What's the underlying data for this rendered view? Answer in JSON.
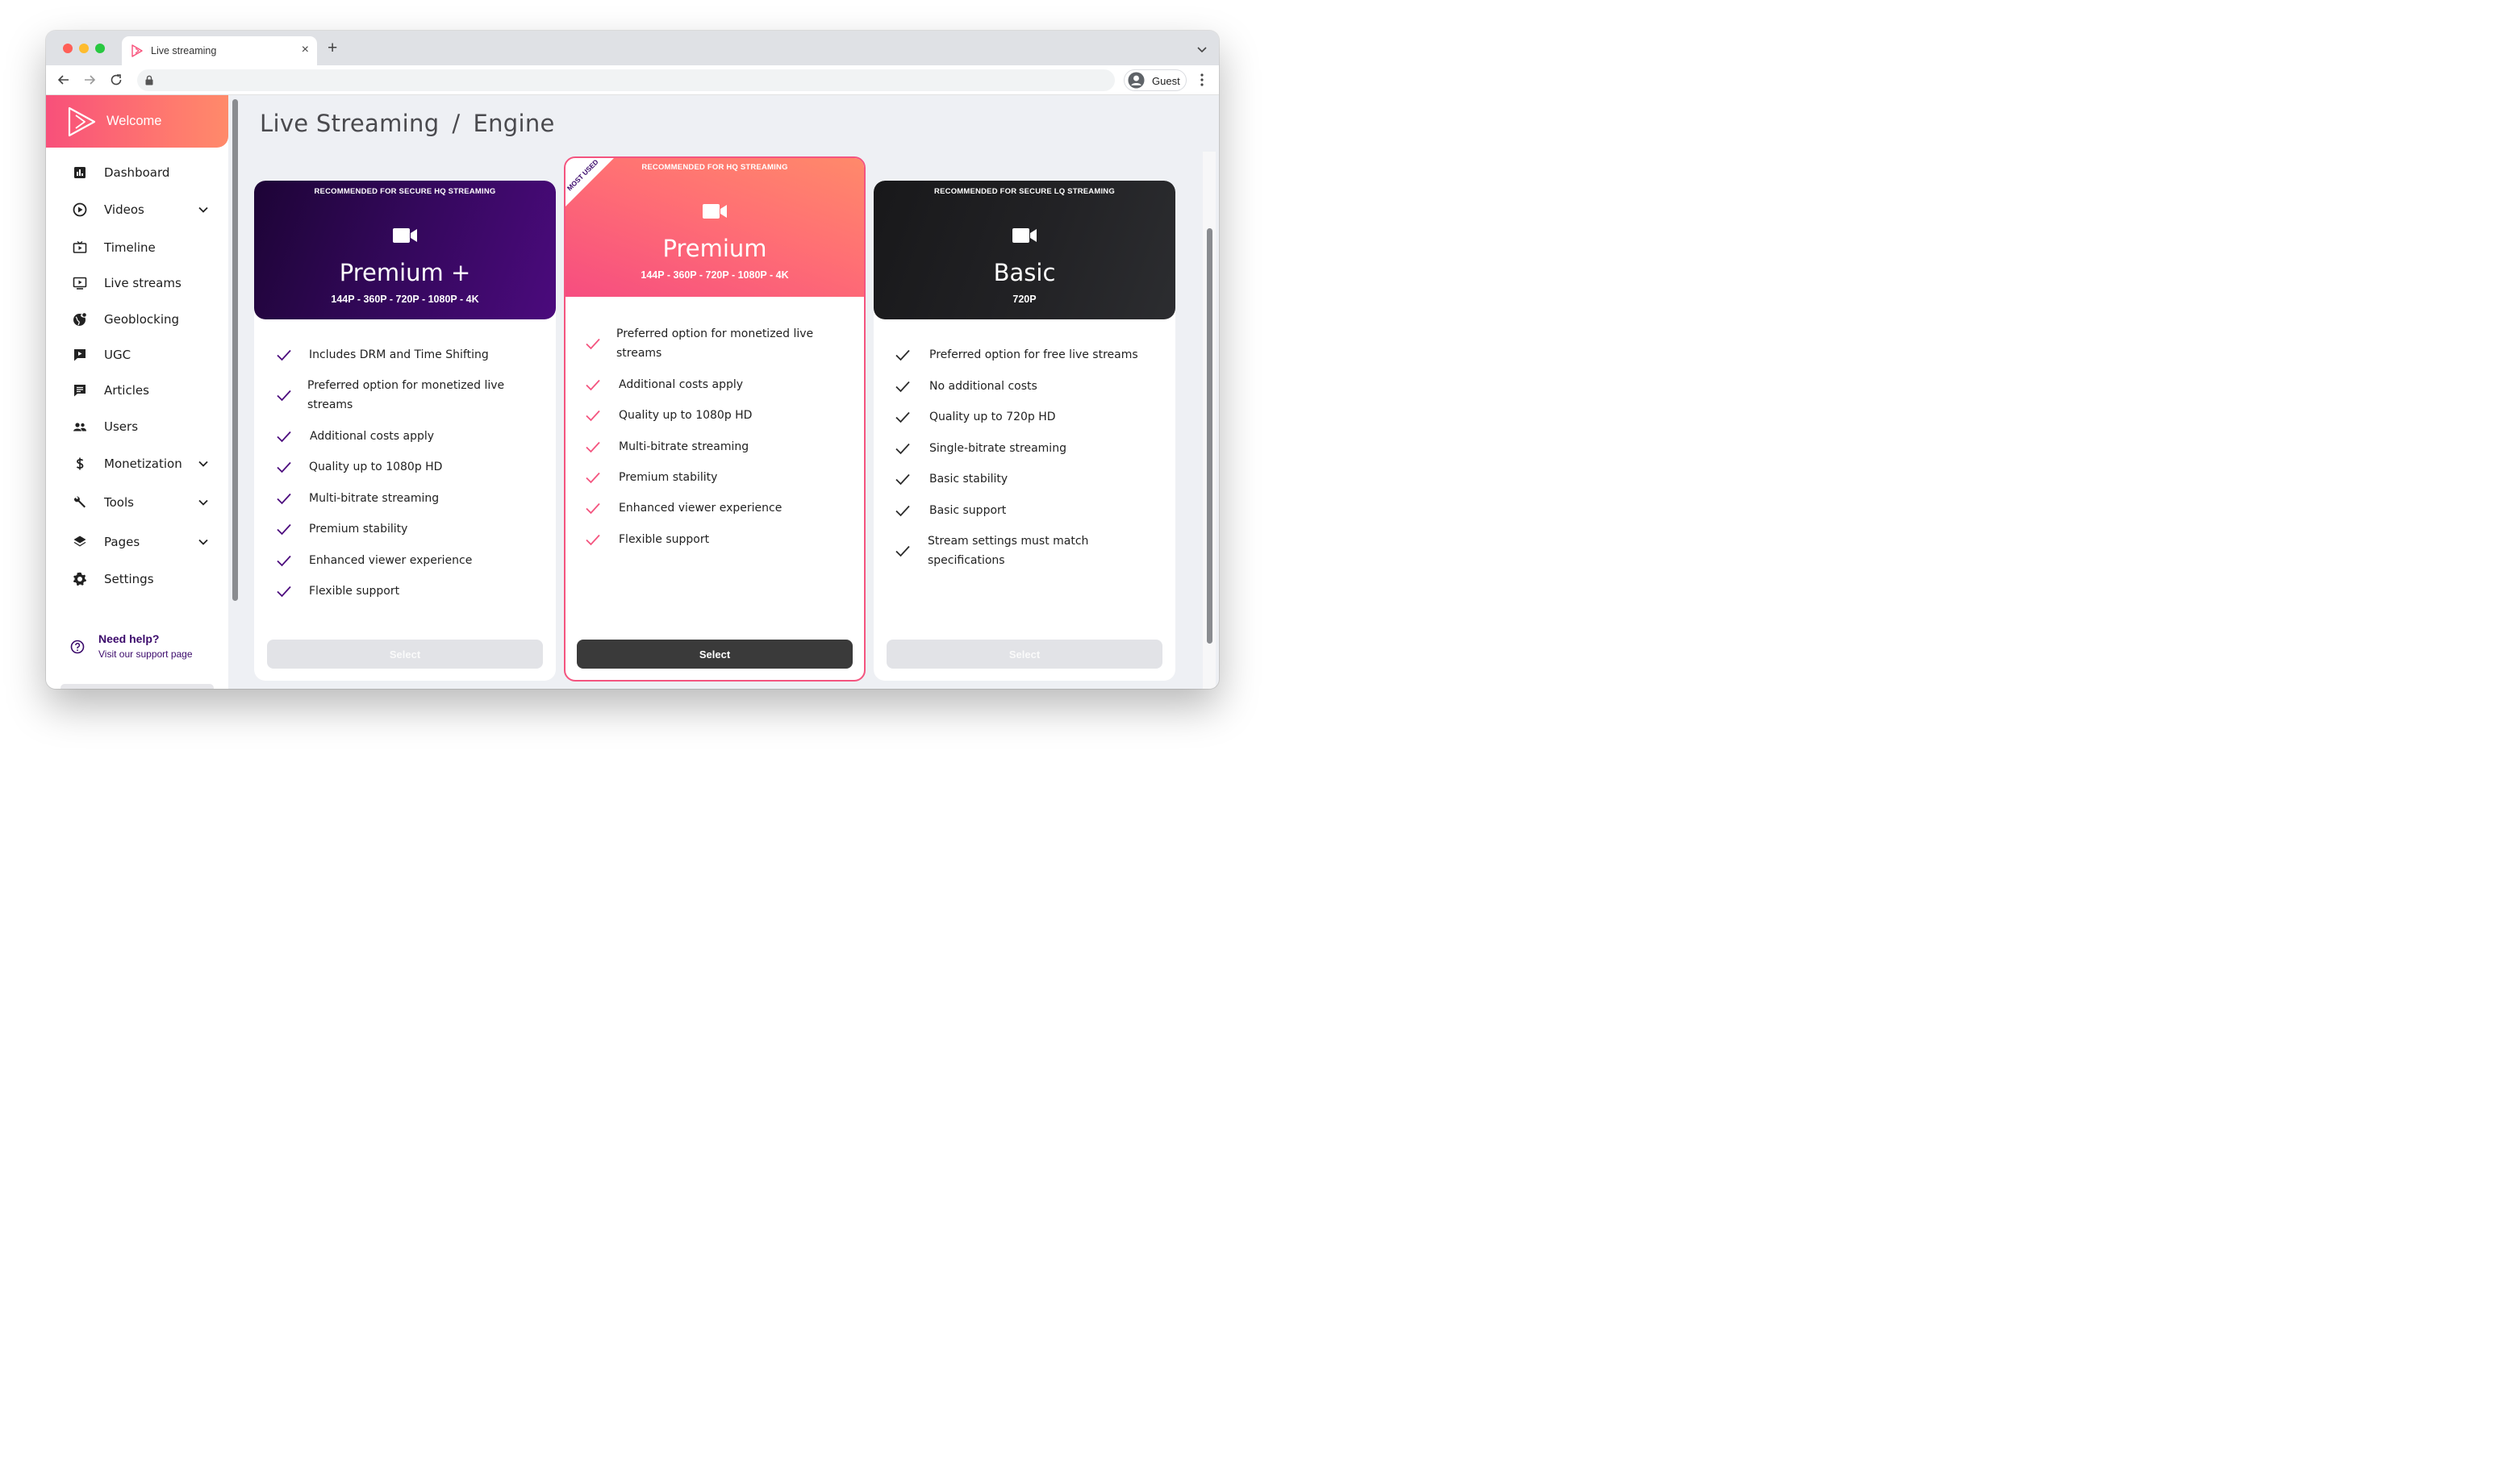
{
  "browser": {
    "tab_title": "Live streaming",
    "new_tab_label": "+",
    "close_label": "×",
    "profile_name": "Guest"
  },
  "sidebar": {
    "welcome_label": "Welcome",
    "items": [
      {
        "label": "Dashboard",
        "icon": "dashboard-icon",
        "has_chevron": false
      },
      {
        "label": "Videos",
        "icon": "play-circle-icon",
        "has_chevron": true
      },
      {
        "label": "Timeline",
        "icon": "timeline-icon",
        "has_chevron": false
      },
      {
        "label": "Live streams",
        "icon": "live-stream-icon",
        "has_chevron": false
      },
      {
        "label": "Geoblocking",
        "icon": "globe-icon",
        "has_chevron": false
      },
      {
        "label": "UGC",
        "icon": "ugc-icon",
        "has_chevron": false
      },
      {
        "label": "Articles",
        "icon": "article-icon",
        "has_chevron": false
      },
      {
        "label": "Users",
        "icon": "users-icon",
        "has_chevron": false
      },
      {
        "label": "Monetization",
        "icon": "dollar-icon",
        "has_chevron": true
      },
      {
        "label": "Tools",
        "icon": "wrench-icon",
        "has_chevron": true
      },
      {
        "label": "Pages",
        "icon": "layers-icon",
        "has_chevron": true
      },
      {
        "label": "Settings",
        "icon": "gear-icon",
        "has_chevron": false
      }
    ],
    "help_title": "Need help?",
    "help_subtitle": "Visit our support page"
  },
  "breadcrumb": {
    "parent": "Live Streaming",
    "separator": "/",
    "current": "Engine"
  },
  "plans": [
    {
      "recommendation": "RECOMMENDED FOR SECURE HQ STREAMING",
      "name": "Premium +",
      "resolutions": "144P - 360P - 720P - 1080P - 4K",
      "features": [
        "Includes DRM and Time Shifting",
        "Preferred option for monetized live streams",
        "Additional costs apply",
        "Quality up to 1080p HD",
        "Multi-bitrate streaming",
        "Premium stability",
        "Enhanced viewer experience",
        "Flexible support"
      ],
      "select_label": "Select",
      "check_color": "#4b0a7d"
    },
    {
      "ribbon": "MOST USED",
      "recommendation": "RECOMMENDED FOR HQ STREAMING",
      "name": "Premium",
      "resolutions": "144P - 360P - 720P - 1080P - 4K",
      "features": [
        "Preferred option for monetized live streams",
        "Additional costs apply",
        "Quality up to 1080p HD",
        "Multi-bitrate streaming",
        "Premium stability",
        "Enhanced viewer experience",
        "Flexible support"
      ],
      "select_label": "Select",
      "check_color": "#f4547f"
    },
    {
      "recommendation": "RECOMMENDED FOR SECURE LQ STREAMING",
      "name": "Basic",
      "resolutions": "720P",
      "features": [
        "Preferred option for free live streams",
        "No additional costs",
        "Quality up to 720p HD",
        "Single-bitrate streaming",
        "Basic stability",
        "Basic support",
        "Stream settings must match specifications"
      ],
      "select_label": "Select",
      "check_color": "#2a2a2a"
    }
  ],
  "colors": {
    "accent_pink": "#f8507a",
    "accent_orange": "#ff8a6a",
    "premium_plus_dark": "#1d0436",
    "premium_plus_light": "#4b0a7d",
    "basic_dark": "#18181a",
    "basic_light": "#2c2d30"
  }
}
